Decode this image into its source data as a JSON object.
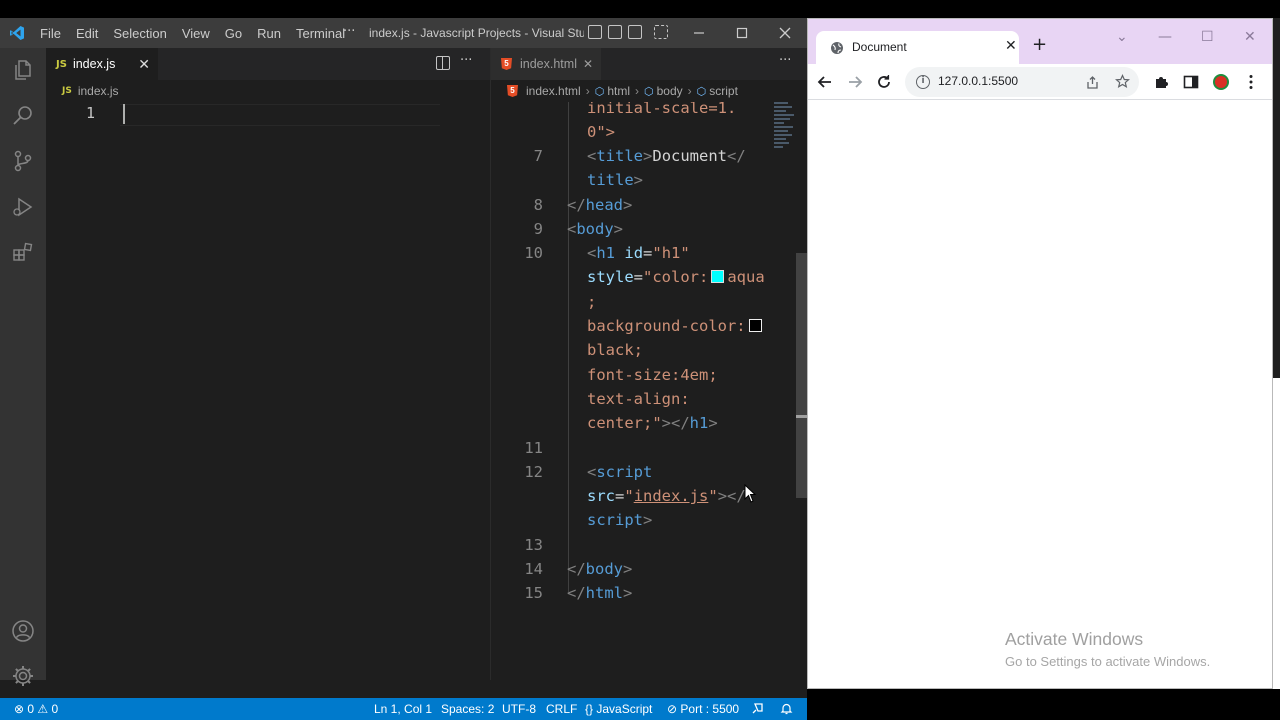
{
  "vscode": {
    "menu": [
      "File",
      "Edit",
      "Selection",
      "View",
      "Go",
      "Run",
      "Terminal"
    ],
    "menu_overflow": "···",
    "window_title": "index.js - Javascript Projects - Visual Studi...",
    "left_editor": {
      "tab_icon": "JS",
      "tab_label": "index.js",
      "tab_close": "✕",
      "breadcrumb_icon": "JS",
      "breadcrumb": "index.js",
      "line_number": "1"
    },
    "right_editor": {
      "tab_icon": "5",
      "tab_label": "index.html",
      "tab_close": "✕",
      "breadcrumb": [
        "index.html",
        "html",
        "body",
        "script"
      ],
      "lines": {
        "l6b": "initial-scale=1.",
        "l6c": "0\">",
        "n7": "7",
        "n8": "8",
        "n9": "9",
        "n10": "10",
        "n11": "11",
        "n12": "12",
        "n13": "13",
        "n14": "14",
        "n15": "15",
        "title_text": "Document"
      }
    },
    "statusbar": {
      "problems": "⊗ 0 ⚠ 0",
      "position": "Ln 1, Col 1",
      "spaces": "Spaces: 2",
      "encoding": "UTF-8",
      "eol": "CRLF",
      "language": "{} JavaScript",
      "port": "⊘ Port : 5500"
    },
    "colors": {
      "statusbar": "#007acc",
      "titlebar": "#3c3c3c",
      "editor": "#1e1e1e"
    }
  },
  "browser": {
    "tab_title": "Document",
    "tab_close": "✕",
    "new_tab": "+",
    "url": "127.0.0.1:5500",
    "watermark_line1": "Activate Windows",
    "watermark_line2": "Go to Settings to activate Windows.",
    "colors": {
      "tabstrip": "#e8d5f4"
    }
  }
}
